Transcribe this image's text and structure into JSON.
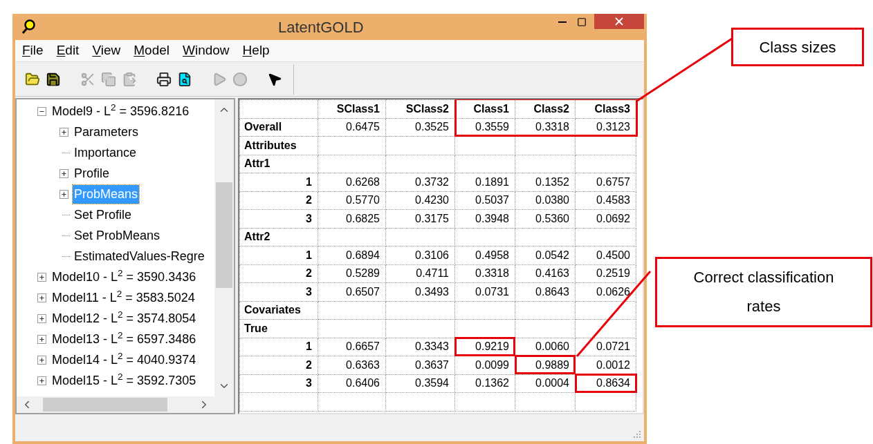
{
  "window": {
    "title": "LatentGOLD"
  },
  "menu": [
    {
      "label": "File"
    },
    {
      "label": "Edit"
    },
    {
      "label": "View"
    },
    {
      "label": "Model"
    },
    {
      "label": "Window"
    },
    {
      "label": "Help"
    }
  ],
  "toolbar": [
    {
      "kind": "open",
      "disabled": false
    },
    {
      "kind": "save",
      "disabled": false
    },
    {
      "kind": "gap"
    },
    {
      "kind": "cut",
      "disabled": true
    },
    {
      "kind": "copy",
      "disabled": true
    },
    {
      "kind": "paste",
      "disabled": true
    },
    {
      "kind": "gap"
    },
    {
      "kind": "print",
      "disabled": false
    },
    {
      "kind": "preview",
      "disabled": false
    },
    {
      "kind": "gap"
    },
    {
      "kind": "run",
      "disabled": true
    },
    {
      "kind": "stop",
      "disabled": true
    },
    {
      "kind": "gap"
    },
    {
      "kind": "help",
      "disabled": false
    }
  ],
  "tree": [
    {
      "label": "Model9 - L$^{2}$ = 3596.8216",
      "kind": "branch",
      "expanded": true,
      "selected": false,
      "children": [
        {
          "label": "Parameters",
          "kind": "branch",
          "expanded": false,
          "selected": false
        },
        {
          "label": "Importance",
          "kind": "leaf",
          "selected": false
        },
        {
          "label": "Profile",
          "kind": "branch",
          "expanded": false,
          "selected": false
        },
        {
          "label": "ProbMeans",
          "kind": "branch",
          "expanded": false,
          "selected": true
        },
        {
          "label": "Set Profile",
          "kind": "leaf",
          "selected": false
        },
        {
          "label": "Set ProbMeans",
          "kind": "leaf",
          "selected": false
        },
        {
          "label": "EstimatedValues-Regre",
          "kind": "leaf",
          "selected": false
        }
      ]
    },
    {
      "label": "Model10 - L$^{2}$ = 3590.3436",
      "kind": "branch",
      "expanded": false,
      "selected": false
    },
    {
      "label": "Model11 - L$^{2}$ = 3583.5024",
      "kind": "branch",
      "expanded": false,
      "selected": false
    },
    {
      "label": "Model12 - L$^{2}$ = 3574.8054",
      "kind": "branch",
      "expanded": false,
      "selected": false
    },
    {
      "label": "Model13 - L$^{2}$ = 6597.3486",
      "kind": "branch",
      "expanded": false,
      "selected": false
    },
    {
      "label": "Model14 - L$^{2}$ = 4040.9374",
      "kind": "branch",
      "expanded": false,
      "selected": false
    },
    {
      "label": "Model15 - L$^{2}$ = 3592.7305",
      "kind": "branch",
      "expanded": false,
      "selected": false
    }
  ],
  "table": {
    "columns": [
      "SClass1",
      "SClass2",
      "Class1",
      "Class2",
      "Class3"
    ],
    "rows": [
      {
        "kind": "group",
        "label": "Overall",
        "cells": [
          "0.6475",
          "0.3525",
          "0.3559",
          "0.3318",
          "0.3123"
        ]
      },
      {
        "kind": "group",
        "label": "Attributes",
        "cells": []
      },
      {
        "kind": "group",
        "label": "Attr1",
        "cells": []
      },
      {
        "kind": "level",
        "label": "1",
        "cells": [
          "0.6268",
          "0.3732",
          "0.1891",
          "0.1352",
          "0.6757"
        ]
      },
      {
        "kind": "level",
        "label": "2",
        "cells": [
          "0.5770",
          "0.4230",
          "0.5037",
          "0.0380",
          "0.4583"
        ]
      },
      {
        "kind": "level",
        "label": "3",
        "cells": [
          "0.6825",
          "0.3175",
          "0.3948",
          "0.5360",
          "0.0692"
        ]
      },
      {
        "kind": "group",
        "label": "Attr2",
        "cells": []
      },
      {
        "kind": "level",
        "label": "1",
        "cells": [
          "0.6894",
          "0.3106",
          "0.4958",
          "0.0542",
          "0.4500"
        ]
      },
      {
        "kind": "level",
        "label": "2",
        "cells": [
          "0.5289",
          "0.4711",
          "0.3318",
          "0.4163",
          "0.2519"
        ]
      },
      {
        "kind": "level",
        "label": "3",
        "cells": [
          "0.6507",
          "0.3493",
          "0.0731",
          "0.8643",
          "0.0626"
        ]
      },
      {
        "kind": "group",
        "label": "Covariates",
        "cells": []
      },
      {
        "kind": "group",
        "label": "True",
        "cells": []
      },
      {
        "kind": "level",
        "label": "1",
        "cells": [
          "0.6657",
          "0.3343",
          "0.9219",
          "0.0060",
          "0.0721"
        ]
      },
      {
        "kind": "level",
        "label": "2",
        "cells": [
          "0.6363",
          "0.3637",
          "0.0099",
          "0.9889",
          "0.0012"
        ]
      },
      {
        "kind": "level",
        "label": "3",
        "cells": [
          "0.6406",
          "0.3594",
          "0.1362",
          "0.0004",
          "0.8634"
        ]
      }
    ]
  },
  "callouts": [
    {
      "text": "Class sizes"
    },
    {
      "text": "Correct classification rates"
    }
  ]
}
